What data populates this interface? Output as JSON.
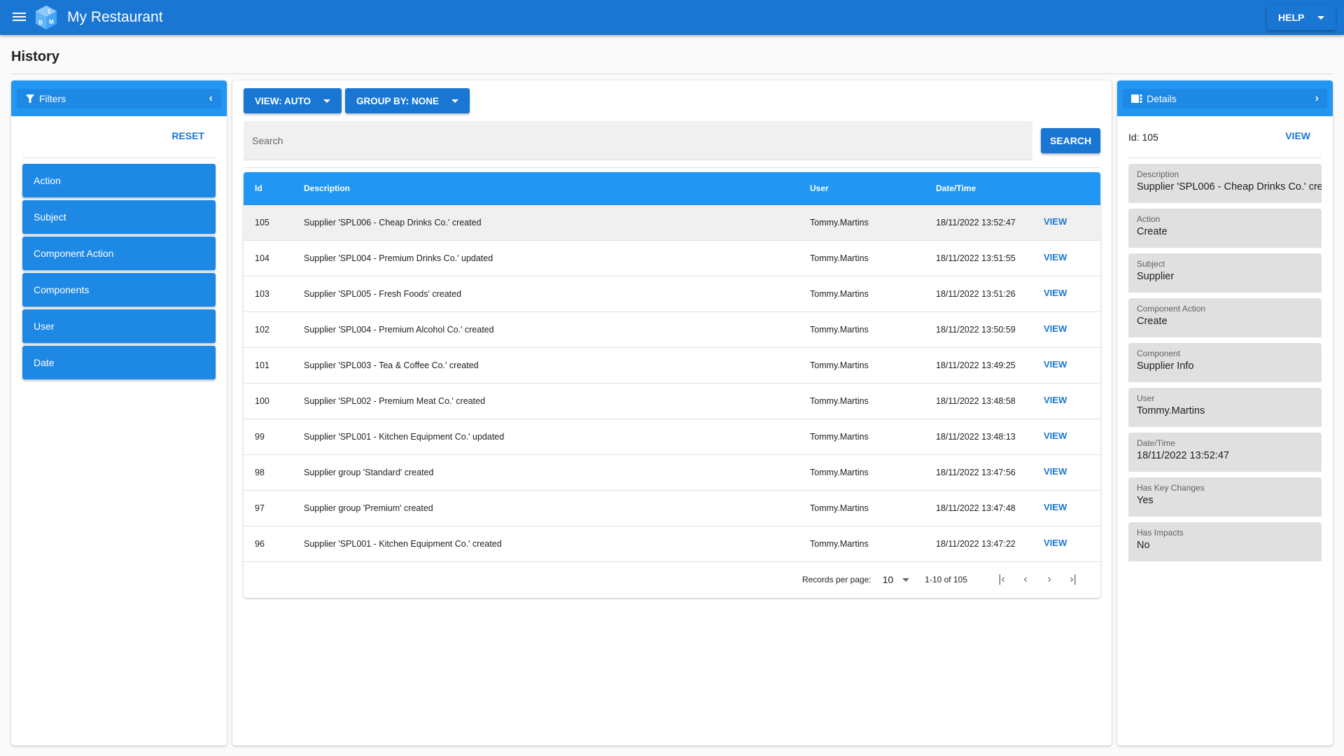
{
  "app": {
    "title": "My Restaurant",
    "help_label": "HELP",
    "brand_color": "#1976d2"
  },
  "page": {
    "title": "History"
  },
  "filters": {
    "title": "Filters",
    "reset_label": "RESET",
    "items": [
      {
        "label": "Action"
      },
      {
        "label": "Subject"
      },
      {
        "label": "Component Action"
      },
      {
        "label": "Components"
      },
      {
        "label": "User"
      },
      {
        "label": "Date"
      }
    ]
  },
  "toolbar": {
    "view_label": "VIEW: AUTO",
    "group_label": "GROUP BY: NONE",
    "search_placeholder": "Search",
    "search_value": "",
    "search_button": "SEARCH"
  },
  "table": {
    "columns": [
      "Id",
      "Description",
      "User",
      "Date/Time"
    ],
    "action_label": "VIEW",
    "rows": [
      {
        "id": "105",
        "description": "Supplier 'SPL006 - Cheap Drinks Co.' created",
        "user": "Tommy.Martins",
        "datetime": "18/11/2022 13:52:47",
        "selected": true
      },
      {
        "id": "104",
        "description": "Supplier 'SPL004 - Premium Drinks Co.' updated",
        "user": "Tommy.Martins",
        "datetime": "18/11/2022 13:51:55"
      },
      {
        "id": "103",
        "description": "Supplier 'SPL005 - Fresh Foods' created",
        "user": "Tommy.Martins",
        "datetime": "18/11/2022 13:51:26"
      },
      {
        "id": "102",
        "description": "Supplier 'SPL004 - Premium Alcohol Co.' created",
        "user": "Tommy.Martins",
        "datetime": "18/11/2022 13:50:59"
      },
      {
        "id": "101",
        "description": "Supplier 'SPL003 - Tea & Coffee Co.' created",
        "user": "Tommy.Martins",
        "datetime": "18/11/2022 13:49:25"
      },
      {
        "id": "100",
        "description": "Supplier 'SPL002 - Premium Meat Co.' created",
        "user": "Tommy.Martins",
        "datetime": "18/11/2022 13:48:58"
      },
      {
        "id": "99",
        "description": "Supplier 'SPL001 - Kitchen Equipment Co.' updated",
        "user": "Tommy.Martins",
        "datetime": "18/11/2022 13:48:13"
      },
      {
        "id": "98",
        "description": "Supplier group 'Standard' created",
        "user": "Tommy.Martins",
        "datetime": "18/11/2022 13:47:56"
      },
      {
        "id": "97",
        "description": "Supplier group 'Premium' created",
        "user": "Tommy.Martins",
        "datetime": "18/11/2022 13:47:48"
      },
      {
        "id": "96",
        "description": "Supplier 'SPL001 - Kitchen Equipment Co.' created",
        "user": "Tommy.Martins",
        "datetime": "18/11/2022 13:47:22"
      }
    ],
    "pagination": {
      "records_per_page_label": "Records per page:",
      "records_per_page": "10",
      "range": "1-10 of 105"
    }
  },
  "details": {
    "title": "Details",
    "id_text": "Id: 105",
    "view_label": "VIEW",
    "fields": [
      {
        "label": "Description",
        "value": "Supplier 'SPL006 - Cheap Drinks Co.' cre"
      },
      {
        "label": "Action",
        "value": "Create"
      },
      {
        "label": "Subject",
        "value": "Supplier"
      },
      {
        "label": "Component Action",
        "value": "Create"
      },
      {
        "label": "Component",
        "value": "Supplier Info"
      },
      {
        "label": "User",
        "value": "Tommy.Martins"
      },
      {
        "label": "Date/Time",
        "value": "18/11/2022 13:52:47"
      },
      {
        "label": "Has Key Changes",
        "value": "Yes"
      },
      {
        "label": "Has Impacts",
        "value": "No"
      }
    ]
  },
  "icons": {
    "menu": "menu-icon",
    "logo": "cube-logo",
    "filter": "filter-funnel-icon",
    "collapse_left": "chevron-left-icon",
    "details": "details-panel-icon",
    "collapse_right": "chevron-right-icon",
    "first_page": "first-page-icon",
    "prev_page": "chevron-left-icon",
    "next_page": "chevron-right-icon",
    "last_page": "last-page-icon"
  }
}
